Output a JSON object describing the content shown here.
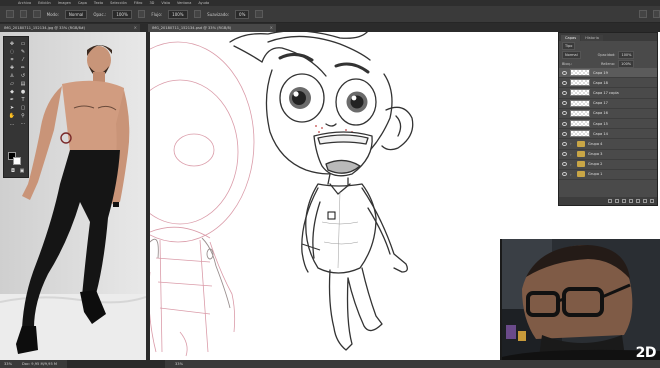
{
  "menubar": {
    "items": [
      "Archivo",
      "Edición",
      "Imagen",
      "Capa",
      "Texto",
      "Selección",
      "Filtro",
      "3D",
      "Vista",
      "Ventana",
      "Ayuda"
    ]
  },
  "options_bar": {
    "mode_label": "Modo:",
    "mode_value": "Normal",
    "opacity_label": "Opac.:",
    "opacity_value": "100%",
    "flow_label": "Flujo:",
    "flow_value": "100%",
    "smoothing_label": "Suavizado:",
    "smoothing_value": "0%"
  },
  "tabs": [
    {
      "label": "IMG_20180711_152134.jpg @ 33% (RGB/8#)",
      "close": "×"
    },
    {
      "label": "IMG_20180711_152134.psd @ 33% (RGB/8)",
      "close": "×"
    }
  ],
  "status_bar": {
    "zoom_left": "33%",
    "doc_left": "Doc: 9,95 M/9,95 M",
    "zoom_right": "33%"
  },
  "layers_panel": {
    "tabs": [
      "Capas",
      "Historia"
    ],
    "kind_filter": "Tipo",
    "blend_mode": "Normal",
    "opacity_label": "Opacidad:",
    "opacity_value": "100%",
    "lock_label": "Bloq.:",
    "fill_label": "Relleno:",
    "fill_value": "100%",
    "layers": [
      {
        "name": "Capa 19",
        "type": "layer",
        "selected": true
      },
      {
        "name": "Capa 18",
        "type": "layer",
        "selected": false
      },
      {
        "name": "Capa 17 copia",
        "type": "layer",
        "selected": false
      },
      {
        "name": "Capa 17",
        "type": "layer",
        "selected": false
      },
      {
        "name": "Capa 16",
        "type": "layer",
        "selected": false
      },
      {
        "name": "Capa 15",
        "type": "layer",
        "selected": false
      },
      {
        "name": "Capa 14",
        "type": "layer",
        "selected": false
      },
      {
        "name": "Grupo 4",
        "type": "group",
        "selected": false
      },
      {
        "name": "Grupo 3",
        "type": "group",
        "selected": false
      },
      {
        "name": "Grupo 2",
        "type": "group",
        "selected": false
      },
      {
        "name": "Grupo 1",
        "type": "group",
        "selected": false
      }
    ]
  },
  "watermark": "2D",
  "icons": {
    "eye": "eye-icon",
    "folder": "folder-icon",
    "brush": "brush-icon",
    "move": "move-icon"
  },
  "colors": {
    "ui_dark": "#2e2e2e",
    "panel": "#4a4a4a",
    "sketch_red": "#d48a9a",
    "line_dark": "#333333"
  }
}
